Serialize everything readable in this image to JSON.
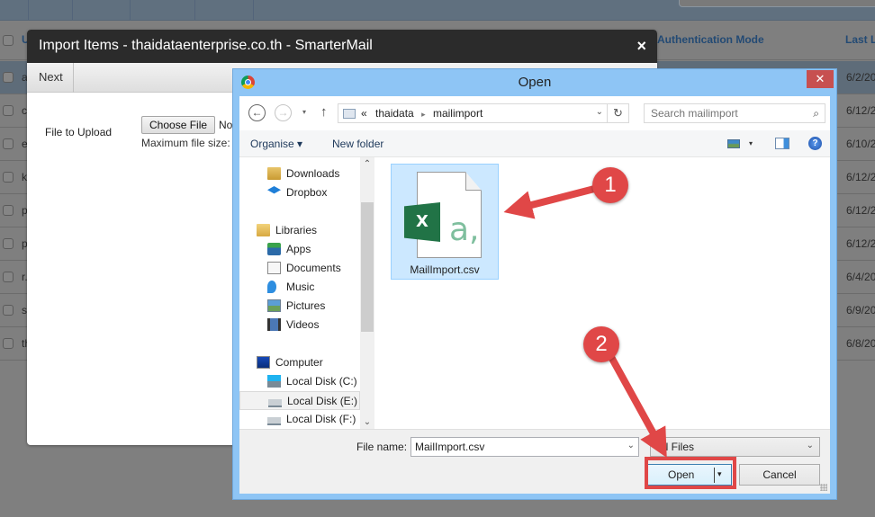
{
  "background": {
    "columns": [
      "Authentication Mode",
      "Last L"
    ],
    "rows": [
      {
        "name": "a",
        "date": "6/2/20",
        "selected": true
      },
      {
        "name": "c",
        "date": "6/12/2"
      },
      {
        "name": "e",
        "date": "6/10/2"
      },
      {
        "name": "k",
        "date": "6/12/2"
      },
      {
        "name": "p",
        "date": "6/12/2"
      },
      {
        "name": "p",
        "date": "6/12/2"
      },
      {
        "name": "r.",
        "date": "6/4/20"
      },
      {
        "name": "s",
        "date": "6/9/20"
      },
      {
        "name": "th",
        "date": "6/8/20"
      }
    ],
    "header_first_letter": "U"
  },
  "import_modal": {
    "title": "Import Items - thaidataenterprise.co.th - SmarterMail",
    "close_icon": "×",
    "next_label": "Next",
    "file_label": "File to Upload",
    "choose_file_label": "Choose File",
    "no_file_text": "No",
    "max_size_text": "Maximum file size:"
  },
  "open_dialog": {
    "title": "Open",
    "close_icon": "✕",
    "nav": {
      "back": "←",
      "forward": "→",
      "recent": "▾",
      "up": "↑"
    },
    "address": {
      "prefix": "«",
      "parts": [
        "thaidata",
        "mailimport"
      ],
      "separator": "▸",
      "dropdown": "⌄",
      "refresh": "↻"
    },
    "search_placeholder": "Search mailimport",
    "commands": {
      "organise": "Organise ▾",
      "new_folder": "New folder",
      "view_dd": "▾",
      "help": "?"
    },
    "nav_pane": [
      {
        "label": "Downloads",
        "icon": "downloads-icon",
        "level": 2
      },
      {
        "label": "Dropbox",
        "icon": "dropbox-icon",
        "level": 2
      },
      {
        "label": "Libraries",
        "icon": "libraries-icon",
        "level": 1
      },
      {
        "label": "Apps",
        "icon": "apps-icon",
        "level": 2
      },
      {
        "label": "Documents",
        "icon": "documents-icon",
        "level": 2
      },
      {
        "label": "Music",
        "icon": "music-icon",
        "level": 2
      },
      {
        "label": "Pictures",
        "icon": "pictures-icon",
        "level": 2
      },
      {
        "label": "Videos",
        "icon": "videos-icon",
        "level": 2
      },
      {
        "label": "Computer",
        "icon": "computer-icon",
        "level": 1
      },
      {
        "label": "Local Disk (C:)",
        "icon": "windows-disk-icon",
        "level": 2
      },
      {
        "label": "Local Disk (E:)",
        "icon": "disk-icon",
        "level": 2,
        "highlighted": true
      },
      {
        "label": "Local Disk (F:)",
        "icon": "disk-icon",
        "level": 2
      }
    ],
    "scroll": {
      "up": "⌃",
      "down": "⌄"
    },
    "files": [
      {
        "name": "MailImport.csv",
        "type": "csv",
        "selected": true,
        "glyph_x": "X",
        "glyph_a": "a,"
      }
    ],
    "file_name_label": "File name:",
    "file_name_value": "MailImport.csv",
    "file_type": "All Files",
    "open_label": "Open",
    "open_split_arrow": "▾",
    "cancel_label": "Cancel"
  },
  "annotations": {
    "step1": "1",
    "step2": "2",
    "color": "#e04747"
  }
}
